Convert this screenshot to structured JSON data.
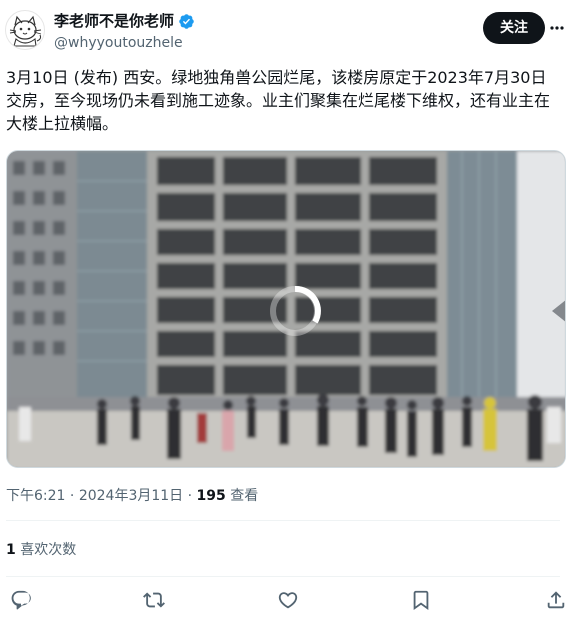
{
  "author": {
    "display_name": "李老师不是你老师",
    "handle": "@whyyoutouzhele",
    "verified": true,
    "avatar_icon": "cat-sketch-avatar"
  },
  "follow_label": "关注",
  "tweet_text": "3月10日 (发布) 西安。绿地独角兽公园烂尾，该楼房原定于2023年7月30日交房，至今现场仍未看到施工迹象。业主们聚集在烂尾楼下维权，还有业主在大楼上拉横幅。",
  "media": {
    "type": "video",
    "state": "loading",
    "icon": "loading-spinner-icon"
  },
  "meta": {
    "time": "下午6:21",
    "sep1": "·",
    "date": "2024年3月11日",
    "sep2": "·",
    "views_count": "195",
    "views_label": "查看"
  },
  "likes": {
    "count": "1",
    "label": "喜欢次数"
  },
  "actions": [
    {
      "name": "reply",
      "icon": "reply-icon"
    },
    {
      "name": "retweet",
      "icon": "retweet-icon"
    },
    {
      "name": "like",
      "icon": "heart-icon"
    },
    {
      "name": "bookmark",
      "icon": "bookmark-icon"
    },
    {
      "name": "share",
      "icon": "share-icon"
    }
  ],
  "colors": {
    "text_primary": "#0f1419",
    "text_secondary": "#536471",
    "verified_blue": "#1d9bf0",
    "divider": "#eff3f4",
    "follow_bg": "#0f1419"
  }
}
